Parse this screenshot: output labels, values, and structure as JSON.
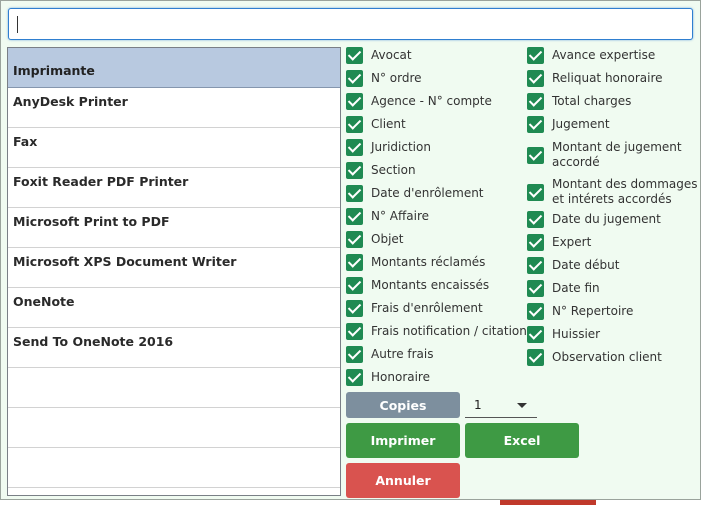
{
  "search": {
    "value": "",
    "placeholder": ""
  },
  "printers": {
    "header": "Imprimante",
    "items": [
      "AnyDesk Printer",
      "Fax",
      "Foxit Reader PDF Printer",
      "Microsoft Print to PDF",
      "Microsoft XPS Document Writer",
      "OneNote",
      "Send To OneNote 2016",
      "",
      "",
      ""
    ]
  },
  "columns_left": [
    {
      "label": "Avocat",
      "checked": true
    },
    {
      "label": "N° ordre",
      "checked": true
    },
    {
      "label": "Agence - N° compte",
      "checked": true
    },
    {
      "label": "Client",
      "checked": true
    },
    {
      "label": "Juridiction",
      "checked": true
    },
    {
      "label": "Section",
      "checked": true
    },
    {
      "label": "Date d'enrôlement",
      "checked": true
    },
    {
      "label": "N° Affaire",
      "checked": true
    },
    {
      "label": "Objet",
      "checked": true
    },
    {
      "label": "Montants réclamés",
      "checked": true
    },
    {
      "label": "Montants encaissés",
      "checked": true
    },
    {
      "label": "Frais d'enrôlement",
      "checked": true
    },
    {
      "label": "Frais notification / citation",
      "checked": true
    },
    {
      "label": "Autre frais",
      "checked": true
    },
    {
      "label": "Honoraire",
      "checked": true
    }
  ],
  "columns_right": [
    {
      "label": "Avance expertise",
      "checked": true
    },
    {
      "label": "Reliquat honoraire",
      "checked": true
    },
    {
      "label": "Total charges",
      "checked": true
    },
    {
      "label": "Jugement",
      "checked": true
    },
    {
      "label_line1": "Montant de jugement",
      "label_line2": "accordé",
      "checked": true
    },
    {
      "label_line1": "Montant des dommages",
      "label_line2": "et intérets accordés",
      "checked": true
    },
    {
      "label": "Date du jugement",
      "checked": true
    },
    {
      "label": "Expert",
      "checked": true
    },
    {
      "label": "Date début",
      "checked": true
    },
    {
      "label": "Date fin",
      "checked": true
    },
    {
      "label": "N° Repertoire",
      "checked": true
    },
    {
      "label": "Huissier",
      "checked": true
    },
    {
      "label": "Observation client",
      "checked": true
    }
  ],
  "copies": {
    "label": "Copies",
    "value": "1"
  },
  "actions": {
    "print": "Imprimer",
    "excel": "Excel",
    "cancel": "Annuler"
  },
  "colors": {
    "checkbox": "#1f8a52",
    "primary_button": "#3e9a44",
    "cancel_button": "#d9534f",
    "copies_button": "#7d8f9e",
    "list_header": "#b8c9e0",
    "panel_bg": "#f0fbf1"
  }
}
